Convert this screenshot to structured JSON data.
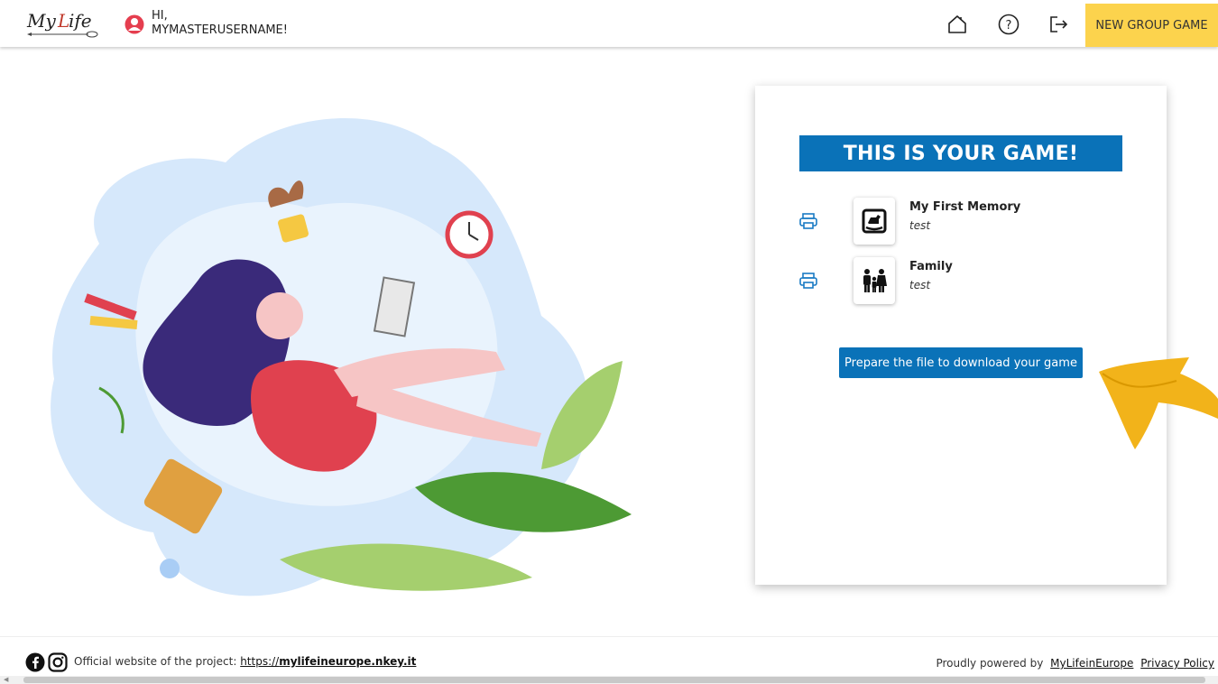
{
  "header": {
    "logo_text": "My Life",
    "greeting_line1": "HI,",
    "greeting_line2": "MYMASTERUSERNAME!",
    "icons": [
      "home-icon",
      "help-icon",
      "logout-icon"
    ],
    "new_group_game_label": "NEW GROUP GAME",
    "accent_color": "#fcd34d"
  },
  "card": {
    "title": "THIS IS YOUR GAME!",
    "items": [
      {
        "name": "My First Memory",
        "subtitle": "test",
        "icon": "rocking-horse-icon"
      },
      {
        "name": "Family",
        "subtitle": "test",
        "icon": "family-icon"
      }
    ],
    "download_label": "Prepare the file to download your game",
    "primary_color": "#0a72b8"
  },
  "footer": {
    "official_text": "Official website of the project:",
    "url_prefix": "https://",
    "url_domain": "mylifeineurope.nkey.it",
    "powered_by": "Proudly powered by",
    "powered_link": "MyLifeinEurope",
    "privacy_label": "Privacy Policy"
  }
}
